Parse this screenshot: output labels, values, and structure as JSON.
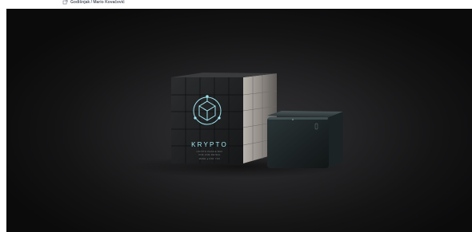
{
  "credit": {
    "icon": "square-corner-icon",
    "text": "Godišnjak / Mario Kovačević"
  },
  "product": {
    "brand": "KRYPTO",
    "fine_line_1": "CRYPTO PUZZLE BOX",
    "fine_line_2": "ONE LINE REVEAL",
    "fine_line_3": "MADE ● FOR YOU"
  },
  "colors": {
    "background": "#141415",
    "accent": "#9fe6f2",
    "cube": "#1e2426"
  }
}
